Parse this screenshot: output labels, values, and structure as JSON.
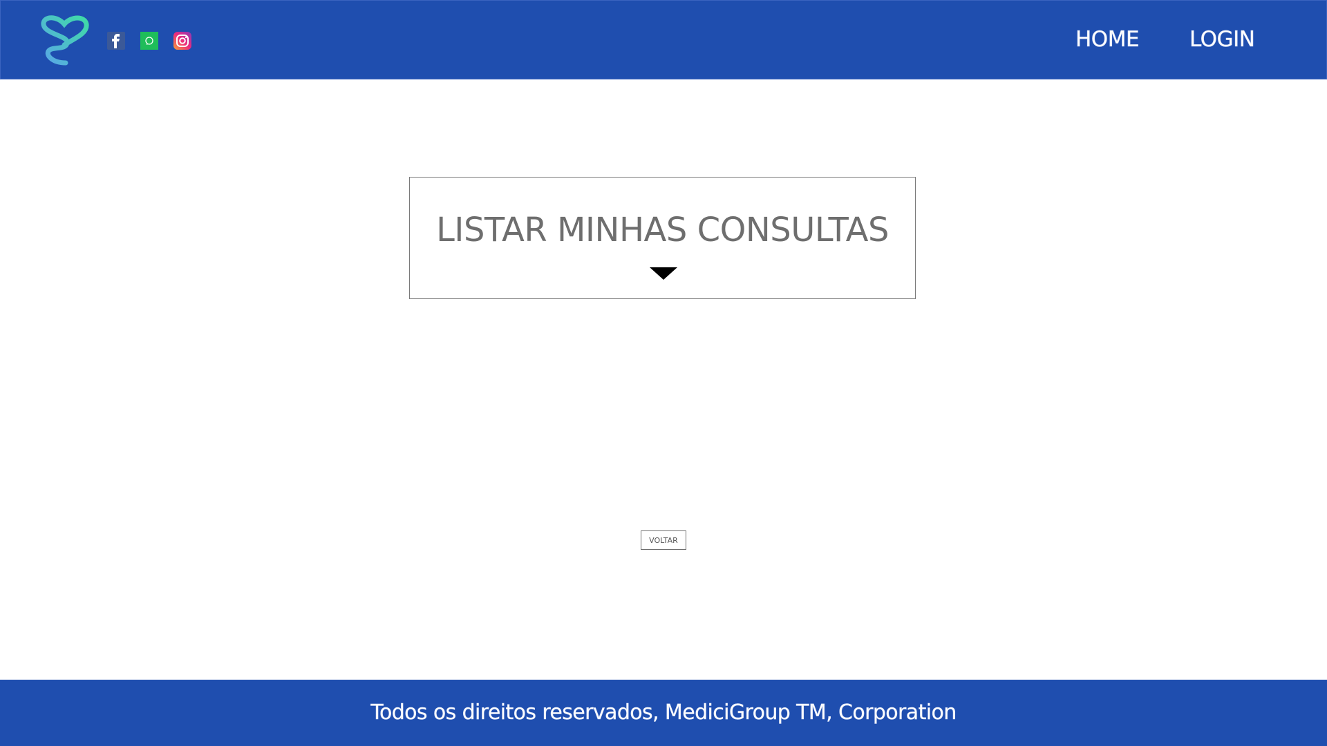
{
  "header": {
    "nav": {
      "home_label": "HOME",
      "login_label": "LOGIN"
    },
    "social_icons": [
      "facebook-icon",
      "whatsapp-icon",
      "instagram-icon"
    ],
    "logo_icon": "heart-stethoscope-logo"
  },
  "main": {
    "list_title": "LISTAR MINHAS CONSULTAS",
    "expand_icon": "caret-down-icon",
    "back_button_label": "VOLTAR"
  },
  "footer": {
    "text": "Todos os direitos reservados, MediciGroup TM, Corporation"
  },
  "colors": {
    "brand_blue": "#1f4eaf",
    "text_gray": "#6e6e6e",
    "logo_gradient_start": "#4fa3e6",
    "logo_gradient_end": "#3ed7a6"
  }
}
